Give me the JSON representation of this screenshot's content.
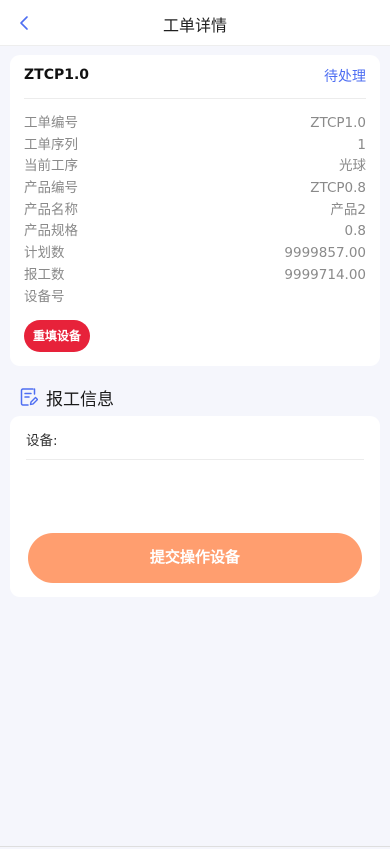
{
  "colors": {
    "accent": "#4e6ef2",
    "danger": "#e7223a",
    "submit": "#ff9e6f",
    "background": "#f5f6fc"
  },
  "nav": {
    "title": "工单详情",
    "back_icon": "chevron-left-icon"
  },
  "work_order": {
    "code": "ZTCP1.0",
    "status": "待处理",
    "fields": [
      {
        "label": "工单编号",
        "value": "ZTCP1.0"
      },
      {
        "label": "工单序列",
        "value": "1"
      },
      {
        "label": "当前工序",
        "value": "光球"
      },
      {
        "label": "产品编号",
        "value": "ZTCP0.8"
      },
      {
        "label": "产品名称",
        "value": "产品2"
      },
      {
        "label": "产品规格",
        "value": "0.8"
      },
      {
        "label": "计划数",
        "value": "9999857.00"
      },
      {
        "label": "报工数",
        "value": "9999714.00"
      },
      {
        "label": "设备号",
        "value": ""
      }
    ],
    "refill_button": "重填设备"
  },
  "report_section": {
    "title": "报工信息",
    "icon": "edit-document-icon",
    "device_label": "设备:",
    "submit_button": "提交操作设备"
  }
}
